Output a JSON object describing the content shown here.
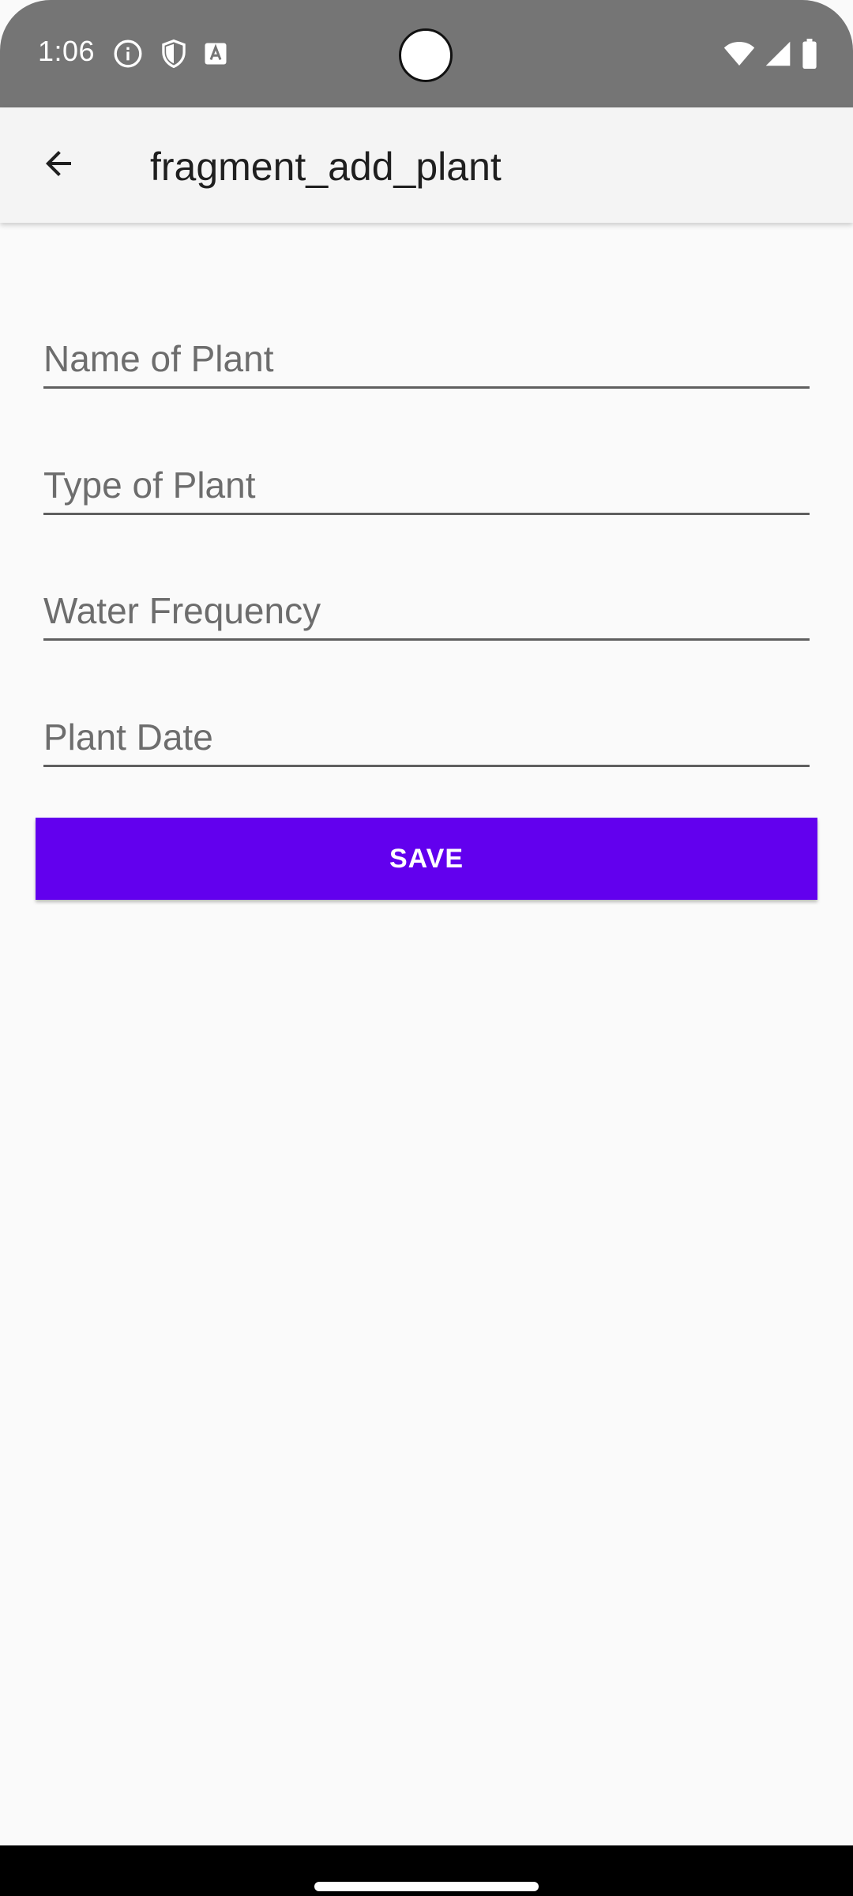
{
  "status_bar": {
    "time": "1:06",
    "left_icons": [
      "info-icon",
      "shield-icon",
      "keyboard-a-icon"
    ],
    "right_icons": [
      "wifi-icon",
      "signal-icon",
      "battery-icon"
    ]
  },
  "app_bar": {
    "title": "fragment_add_plant",
    "back_icon": "arrow-back-icon"
  },
  "form": {
    "fields": [
      {
        "placeholder": "Name of Plant",
        "value": ""
      },
      {
        "placeholder": "Type of Plant",
        "value": ""
      },
      {
        "placeholder": "Water Frequency",
        "value": ""
      },
      {
        "placeholder": "Plant Date",
        "value": ""
      }
    ],
    "save_label": "SAVE"
  },
  "colors": {
    "accent": "#6200ee",
    "status_bar": "#757575",
    "app_bar": "#f4f4f4",
    "background": "#fafafa"
  }
}
